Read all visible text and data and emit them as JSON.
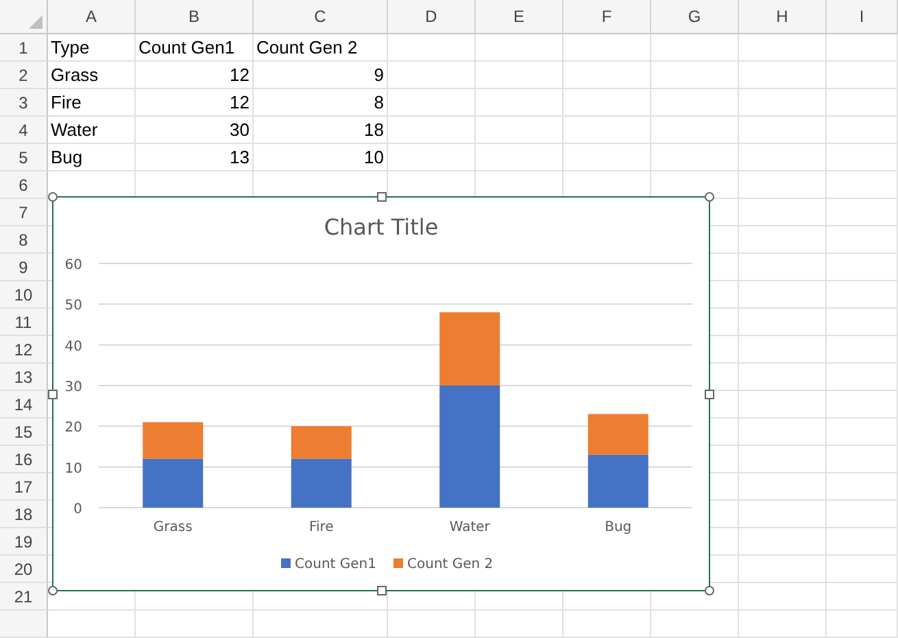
{
  "columns": [
    "A",
    "B",
    "C",
    "D",
    "E",
    "F",
    "G",
    "H",
    "I"
  ],
  "row_numbers": [
    "1",
    "2",
    "3",
    "4",
    "5",
    "6",
    "7",
    "8",
    "9",
    "10",
    "11",
    "12",
    "13",
    "14",
    "15",
    "16",
    "17",
    "18",
    "19",
    "20",
    "21"
  ],
  "cells": [
    [
      {
        "text": "Type",
        "kind": "text"
      },
      {
        "text": "Count Gen1",
        "kind": "text"
      },
      {
        "text": "Count Gen 2",
        "kind": "text"
      }
    ],
    [
      {
        "text": "Grass",
        "kind": "text"
      },
      {
        "text": "12",
        "kind": "number"
      },
      {
        "text": "9",
        "kind": "number"
      }
    ],
    [
      {
        "text": "Fire",
        "kind": "text"
      },
      {
        "text": "12",
        "kind": "number"
      },
      {
        "text": "8",
        "kind": "number"
      }
    ],
    [
      {
        "text": "Water",
        "kind": "text"
      },
      {
        "text": "30",
        "kind": "number"
      },
      {
        "text": "18",
        "kind": "number"
      }
    ],
    [
      {
        "text": "Bug",
        "kind": "text"
      },
      {
        "text": "13",
        "kind": "number"
      },
      {
        "text": "10",
        "kind": "number"
      }
    ]
  ],
  "chart": {
    "chart_data": {
      "type": "bar",
      "title": "Chart Title",
      "grid": true,
      "legend": true,
      "categories": [
        "Grass",
        "Fire",
        "Water",
        "Bug"
      ],
      "stacked": true,
      "ylim": [
        0,
        60
      ],
      "yticks": [
        0,
        10,
        20,
        30,
        40,
        50,
        60
      ],
      "series": [
        {
          "name": "Count Gen1",
          "color": "#4472c4",
          "values": [
            12,
            12,
            30,
            13
          ]
        },
        {
          "name": "Count Gen 2",
          "color": "#ed7d31",
          "values": [
            9,
            8,
            18,
            10
          ]
        }
      ]
    }
  }
}
